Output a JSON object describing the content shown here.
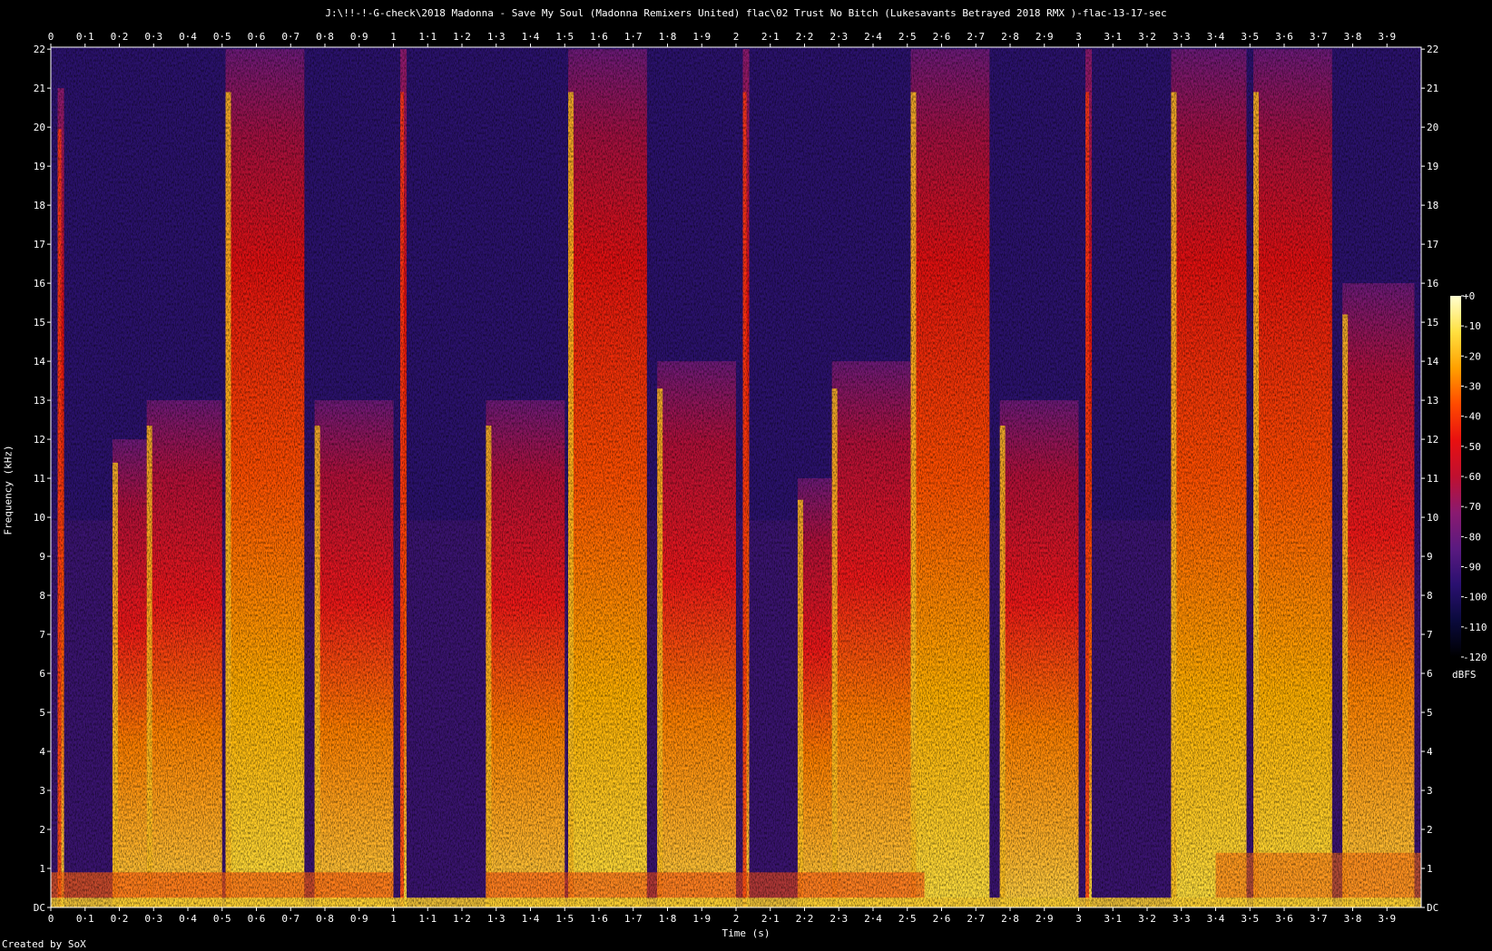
{
  "chart_data": {
    "type": "heatmap",
    "title": "J:\\!!-!-G-check\\2018 Madonna - Save My Soul (Madonna Remixers United) flac\\02 Trust No Bitch (Lukesavants Betrayed 2018 RMX )-flac-13-17-sec",
    "xlabel": "Time (s)",
    "ylabel": "Frequency (kHz)",
    "credit": "Created by SoX",
    "colorbar_unit": "dBFS",
    "xlim": [
      0,
      4
    ],
    "ylim": [
      0,
      22.05
    ],
    "x_ticks": [
      "0",
      "0·1",
      "0·2",
      "0·3",
      "0·4",
      "0·5",
      "0·6",
      "0·7",
      "0·8",
      "0·9",
      "1",
      "1·1",
      "1·2",
      "1·3",
      "1·4",
      "1·5",
      "1·6",
      "1·7",
      "1·8",
      "1·9",
      "2",
      "2·1",
      "2·2",
      "2·3",
      "2·4",
      "2·5",
      "2·6",
      "2·7",
      "2·8",
      "2·9",
      "3",
      "3·1",
      "3·2",
      "3·3",
      "3·4",
      "3·5",
      "3·6",
      "3·7",
      "3·8",
      "3·9"
    ],
    "y_ticks": [
      "DC",
      "1",
      "2",
      "3",
      "4",
      "5",
      "6",
      "7",
      "8",
      "9",
      "10",
      "11",
      "12",
      "13",
      "14",
      "15",
      "16",
      "17",
      "18",
      "19",
      "20",
      "21",
      "22"
    ],
    "colorbar_ticks": [
      "+0",
      "-10",
      "-20",
      "-30",
      "-40",
      "-50",
      "-60",
      "-70",
      "-80",
      "-90",
      "-100",
      "-110",
      "-120"
    ],
    "colorbar_range": [
      -120,
      0
    ],
    "colormap": [
      "#000000",
      "#0a0a3c",
      "#2a1070",
      "#5a1a80",
      "#8a1a70",
      "#c01030",
      "#e81010",
      "#ff4a00",
      "#ffa000",
      "#ffe040",
      "#ffffd0"
    ],
    "events": [
      {
        "t": 0.02,
        "type": "transient",
        "top_khz": 21
      },
      {
        "t": 0.18,
        "type": "sustained",
        "end": 0.28,
        "top_khz": 12
      },
      {
        "t": 0.28,
        "type": "sustained",
        "end": 0.5,
        "top_khz": 13
      },
      {
        "t": 0.51,
        "type": "burst",
        "end": 0.74,
        "top_khz": 22
      },
      {
        "t": 0.77,
        "type": "sustained",
        "end": 1.0,
        "top_khz": 13
      },
      {
        "t": 1.02,
        "type": "transient",
        "top_khz": 22
      },
      {
        "t": 1.27,
        "type": "sustained",
        "end": 1.5,
        "top_khz": 13
      },
      {
        "t": 1.51,
        "type": "burst",
        "end": 1.74,
        "top_khz": 22
      },
      {
        "t": 1.77,
        "type": "sustained",
        "end": 2.0,
        "top_khz": 14
      },
      {
        "t": 2.02,
        "type": "transient",
        "top_khz": 22
      },
      {
        "t": 2.18,
        "type": "sustained",
        "end": 2.28,
        "top_khz": 11
      },
      {
        "t": 2.28,
        "type": "sustained",
        "end": 2.51,
        "top_khz": 14
      },
      {
        "t": 2.51,
        "type": "burst",
        "end": 2.74,
        "top_khz": 22
      },
      {
        "t": 2.77,
        "type": "sustained",
        "end": 3.0,
        "top_khz": 13
      },
      {
        "t": 3.02,
        "type": "transient",
        "top_khz": 22
      },
      {
        "t": 3.27,
        "type": "burst",
        "end": 3.49,
        "top_khz": 22
      },
      {
        "t": 3.51,
        "type": "burst",
        "end": 3.74,
        "top_khz": 22
      },
      {
        "t": 3.77,
        "type": "sustained",
        "end": 3.98,
        "top_khz": 16
      }
    ]
  }
}
